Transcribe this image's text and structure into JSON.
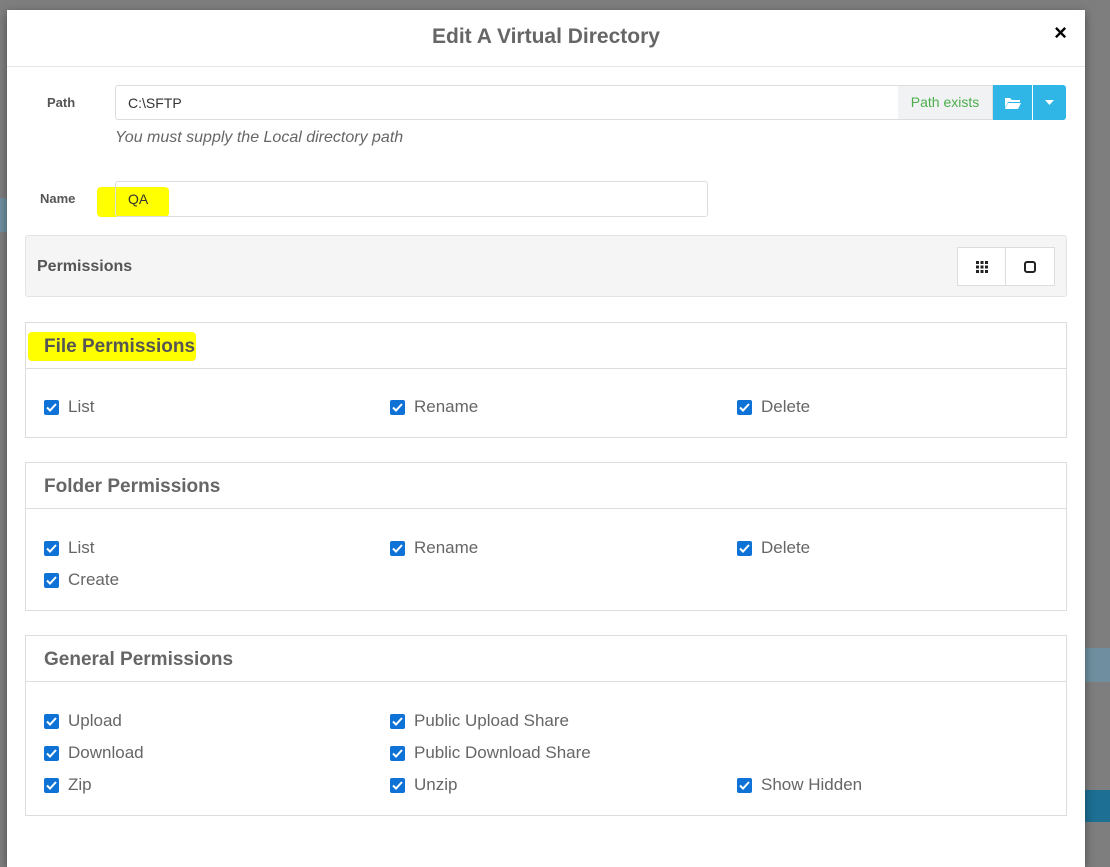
{
  "modal": {
    "title": "Edit A Virtual Directory",
    "close_label": "×"
  },
  "path": {
    "label": "Path",
    "value": "C:\\SFTP",
    "status": "Path exists",
    "help": "You must supply the Local directory path"
  },
  "name": {
    "label": "Name",
    "value": "QA"
  },
  "permissions": {
    "title": "Permissions"
  },
  "file_permissions": {
    "title": "File Permissions",
    "items": [
      {
        "label": "List",
        "checked": true
      },
      {
        "label": "Rename",
        "checked": true
      },
      {
        "label": "Delete",
        "checked": true
      }
    ]
  },
  "folder_permissions": {
    "title": "Folder Permissions",
    "items": [
      {
        "label": "List",
        "checked": true
      },
      {
        "label": "Rename",
        "checked": true
      },
      {
        "label": "Delete",
        "checked": true
      },
      {
        "label": "Create",
        "checked": true
      }
    ]
  },
  "general_permissions": {
    "title": "General Permissions",
    "items": [
      {
        "label": "Upload",
        "checked": true
      },
      {
        "label": "Public Upload Share",
        "checked": true
      },
      {
        "label": "Download",
        "checked": true
      },
      {
        "label": "Public Download Share",
        "checked": true
      },
      {
        "label": "Zip",
        "checked": true
      },
      {
        "label": "Unzip",
        "checked": true
      },
      {
        "label": "Show Hidden",
        "checked": true
      }
    ]
  },
  "colors": {
    "checkbox": "#0e72d6",
    "info_button": "#2fb6e6",
    "success_text": "#4cae4c",
    "highlight": "#ffff00"
  }
}
